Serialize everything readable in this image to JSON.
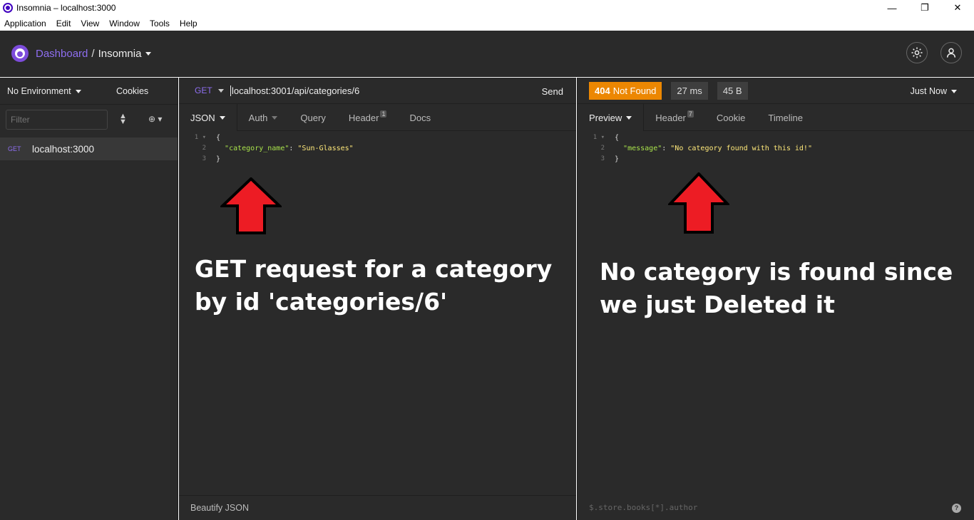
{
  "window": {
    "title": "Insomnia – localhost:3000",
    "controls": [
      "—",
      "❐",
      "✕"
    ]
  },
  "menu": [
    "Application",
    "Edit",
    "View",
    "Window",
    "Tools",
    "Help"
  ],
  "header": {
    "dashboard": "Dashboard",
    "separator": "/",
    "workspace": "Insomnia"
  },
  "sidebar": {
    "environment": "No Environment",
    "cookies": "Cookies",
    "filter_placeholder": "Filter",
    "requests": [
      {
        "method": "GET",
        "name": "localhost:3000"
      }
    ]
  },
  "request": {
    "method": "GET",
    "url": "localhost:3001/api/categories/6",
    "send": "Send",
    "tabs": [
      {
        "label": "JSON",
        "active": true
      },
      {
        "label": "Auth"
      },
      {
        "label": "Query"
      },
      {
        "label": "Header",
        "badge": "1"
      },
      {
        "label": "Docs"
      }
    ],
    "body_lines": [
      {
        "num": "1",
        "text": "{"
      },
      {
        "num": "2",
        "key": "\"category_name\"",
        "value": "\"Sun-Glasses\""
      },
      {
        "num": "3",
        "text": "}"
      }
    ],
    "footer": "Beautify JSON"
  },
  "response": {
    "status_code": "404",
    "status_text": "Not Found",
    "time": "27 ms",
    "size": "45 B",
    "when": "Just Now",
    "tabs": [
      {
        "label": "Preview",
        "active": true
      },
      {
        "label": "Header",
        "badge": "7"
      },
      {
        "label": "Cookie"
      },
      {
        "label": "Timeline"
      }
    ],
    "body_lines": [
      {
        "num": "1",
        "text": "{"
      },
      {
        "num": "2",
        "key": "\"message\"",
        "value": "\"No category found with this id!\""
      },
      {
        "num": "3",
        "text": "}"
      }
    ],
    "filter_placeholder": "$.store.books[*].author"
  },
  "annotations": {
    "left_line1": "GET request for a category",
    "left_line2": "by id 'categories/6'",
    "right_line1": "No category is found since",
    "right_line2": "we just Deleted it"
  },
  "colors": {
    "accent": "#8e6ef0",
    "status_error": "#ec8702",
    "arrow": "#ed1c24"
  }
}
